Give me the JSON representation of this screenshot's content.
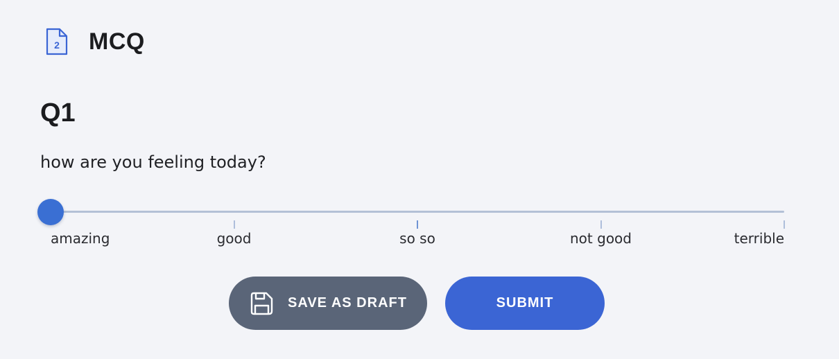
{
  "header": {
    "icon": "document-number-icon",
    "icon_badge": "2",
    "title": "MCQ"
  },
  "question": {
    "number": "Q1",
    "text": "how are you feeling today?"
  },
  "slider": {
    "selected_index": 0,
    "options": [
      "amazing",
      "good",
      "so so",
      "not good",
      "terrible"
    ]
  },
  "actions": {
    "save_draft_label": "SAVE AS DRAFT",
    "save_draft_icon": "floppy-disk-icon",
    "submit_label": "SUBMIT"
  },
  "colors": {
    "background": "#f3f4f8",
    "primary": "#3b65d4",
    "secondary": "#5a6578",
    "track": "#b3c0d6"
  }
}
